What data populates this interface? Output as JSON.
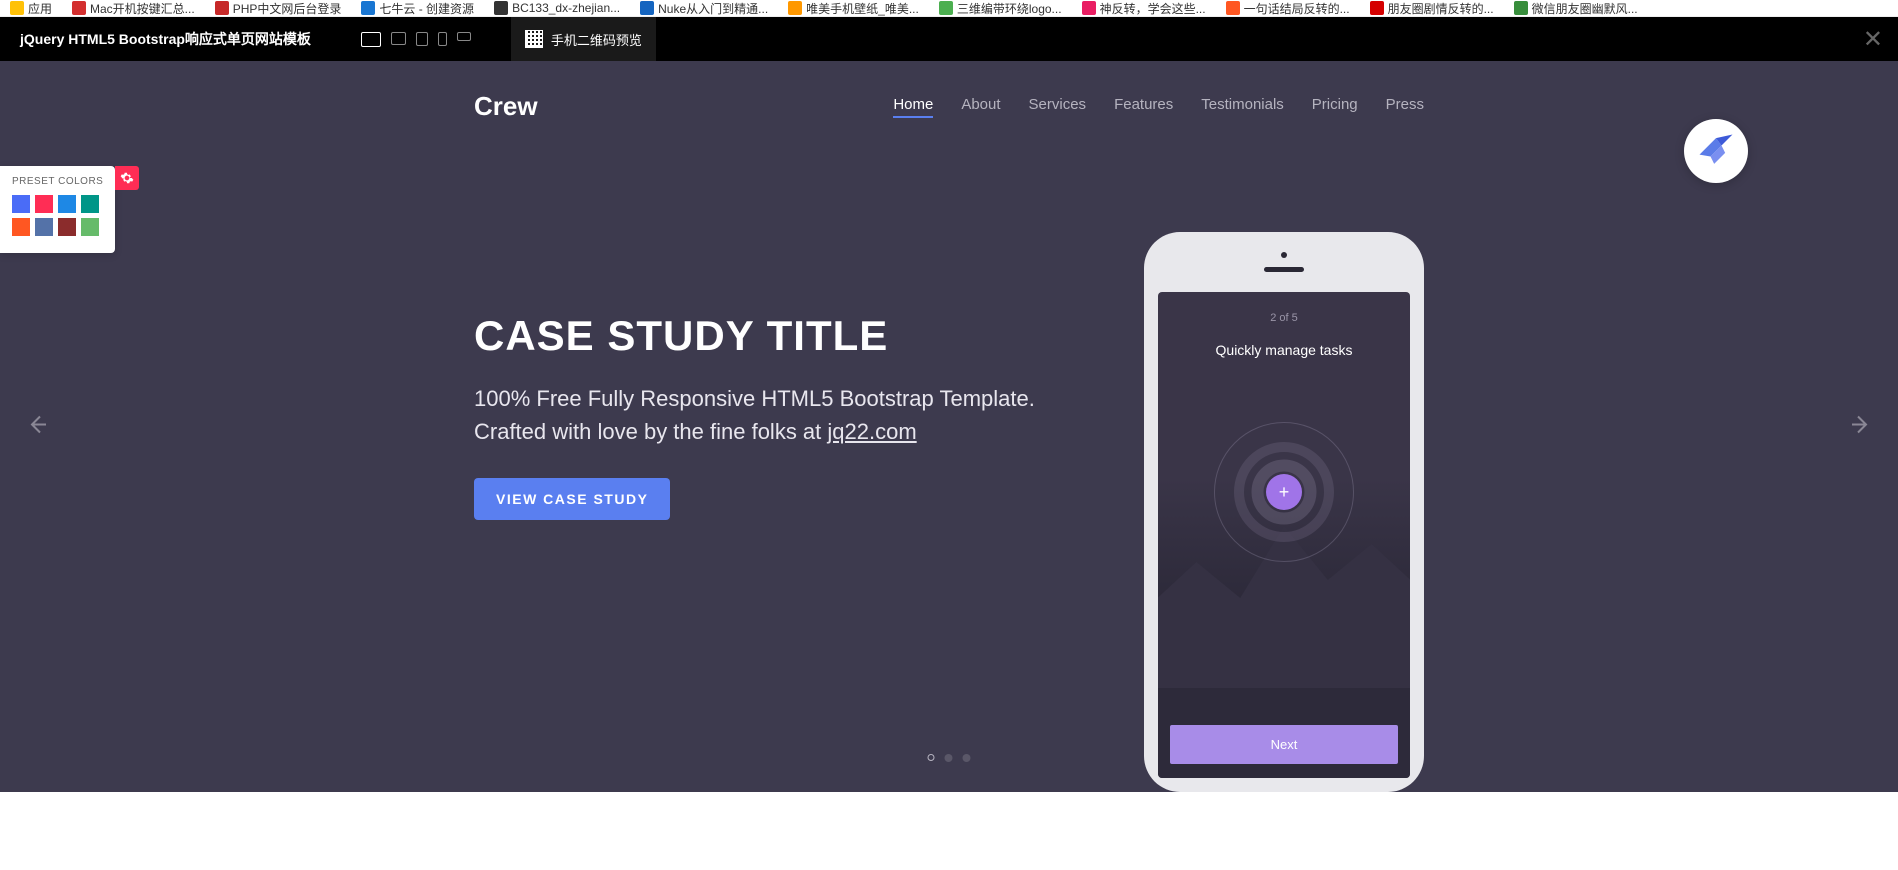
{
  "bookmarks": [
    {
      "label": "应用",
      "color": "#ffc107"
    },
    {
      "label": "Mac开机按键汇总...",
      "color": "#d32f2f"
    },
    {
      "label": "PHP中文网后台登录",
      "color": "#c62828"
    },
    {
      "label": "七牛云 - 创建资源",
      "color": "#1976d2"
    },
    {
      "label": "BC133_dx-zhejian...",
      "color": "#333"
    },
    {
      "label": "Nuke从入门到精通...",
      "color": "#1565c0"
    },
    {
      "label": "唯美手机壁纸_唯美...",
      "color": "#ff9800"
    },
    {
      "label": "三维编带环绕logo...",
      "color": "#4caf50"
    },
    {
      "label": "神反转，学会这些...",
      "color": "#e91e63"
    },
    {
      "label": "一句话结局反转的...",
      "color": "#ff5722"
    },
    {
      "label": "朋友圈剧情反转的...",
      "color": "#d50000"
    },
    {
      "label": "微信朋友圈幽默风...",
      "color": "#388e3c"
    }
  ],
  "preview": {
    "title": "jQuery HTML5 Bootstrap响应式单页网站模板",
    "qr_label": "手机二维码预览"
  },
  "site": {
    "brand": "Crew",
    "nav": [
      "Home",
      "About",
      "Services",
      "Features",
      "Testimonials",
      "Pricing",
      "Press"
    ]
  },
  "hero": {
    "title": "CASE STUDY TITLE",
    "desc_1": "100% Free Fully Responsive HTML5 Bootstrap Template. Crafted with love by the fine folks at ",
    "desc_link": "jq22.com",
    "cta": "VIEW CASE STUDY"
  },
  "phone": {
    "counter": "2 of 5",
    "title": "Quickly manage tasks",
    "next": "Next"
  },
  "colors": {
    "panel_title": "PRESET COLORS",
    "row1": [
      "#4a6cf7",
      "#ff2d55",
      "#1e88e5",
      "#009688"
    ],
    "row2": [
      "#ff5722",
      "#5472a8",
      "#8b2c2c",
      "#66bb6a"
    ]
  }
}
